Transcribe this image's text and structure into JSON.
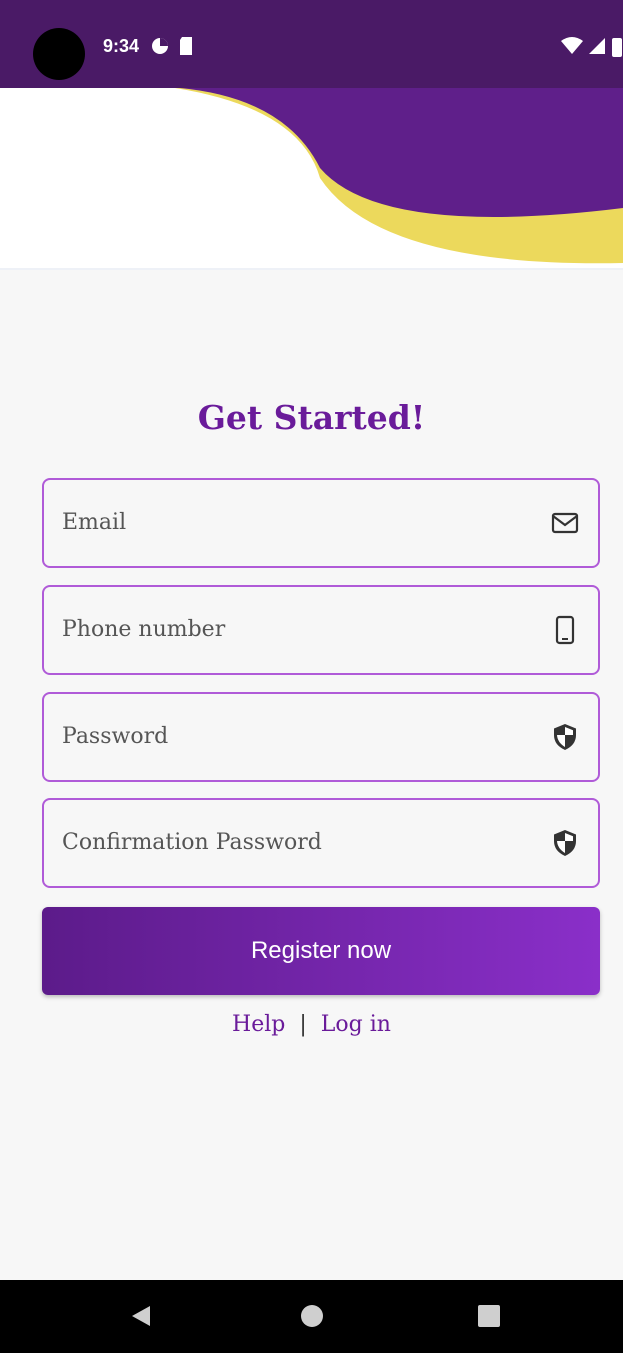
{
  "status_bar": {
    "time": "9:34",
    "icons": [
      "camera-cutout-icon",
      "data-saver-icon",
      "sd-card-icon",
      "wifi-icon",
      "cell-signal-icon",
      "battery-icon"
    ]
  },
  "colors": {
    "status_bar_bg": "#4a1a66",
    "brand_purple": "#6a1b9a",
    "wave_purple": "#5f1f8a",
    "wave_yellow": "#ecd95c",
    "field_border": "#b05bd8",
    "button_gradient_start": "#5c1b8a",
    "button_gradient_end": "#8a2fc9"
  },
  "form": {
    "title": "Get Started!",
    "fields": [
      {
        "placeholder": "Email",
        "icon": "mail-icon"
      },
      {
        "placeholder": "Phone number",
        "icon": "phone-icon"
      },
      {
        "placeholder": "Password",
        "icon": "shield-icon"
      },
      {
        "placeholder": "Confirmation Password",
        "icon": "shield-icon"
      }
    ],
    "register_label": "Register now"
  },
  "links": {
    "help": "Help",
    "separator": "|",
    "login": "Log in"
  },
  "nav_bar": {
    "icons": [
      "back-icon",
      "home-icon",
      "recents-icon"
    ]
  }
}
